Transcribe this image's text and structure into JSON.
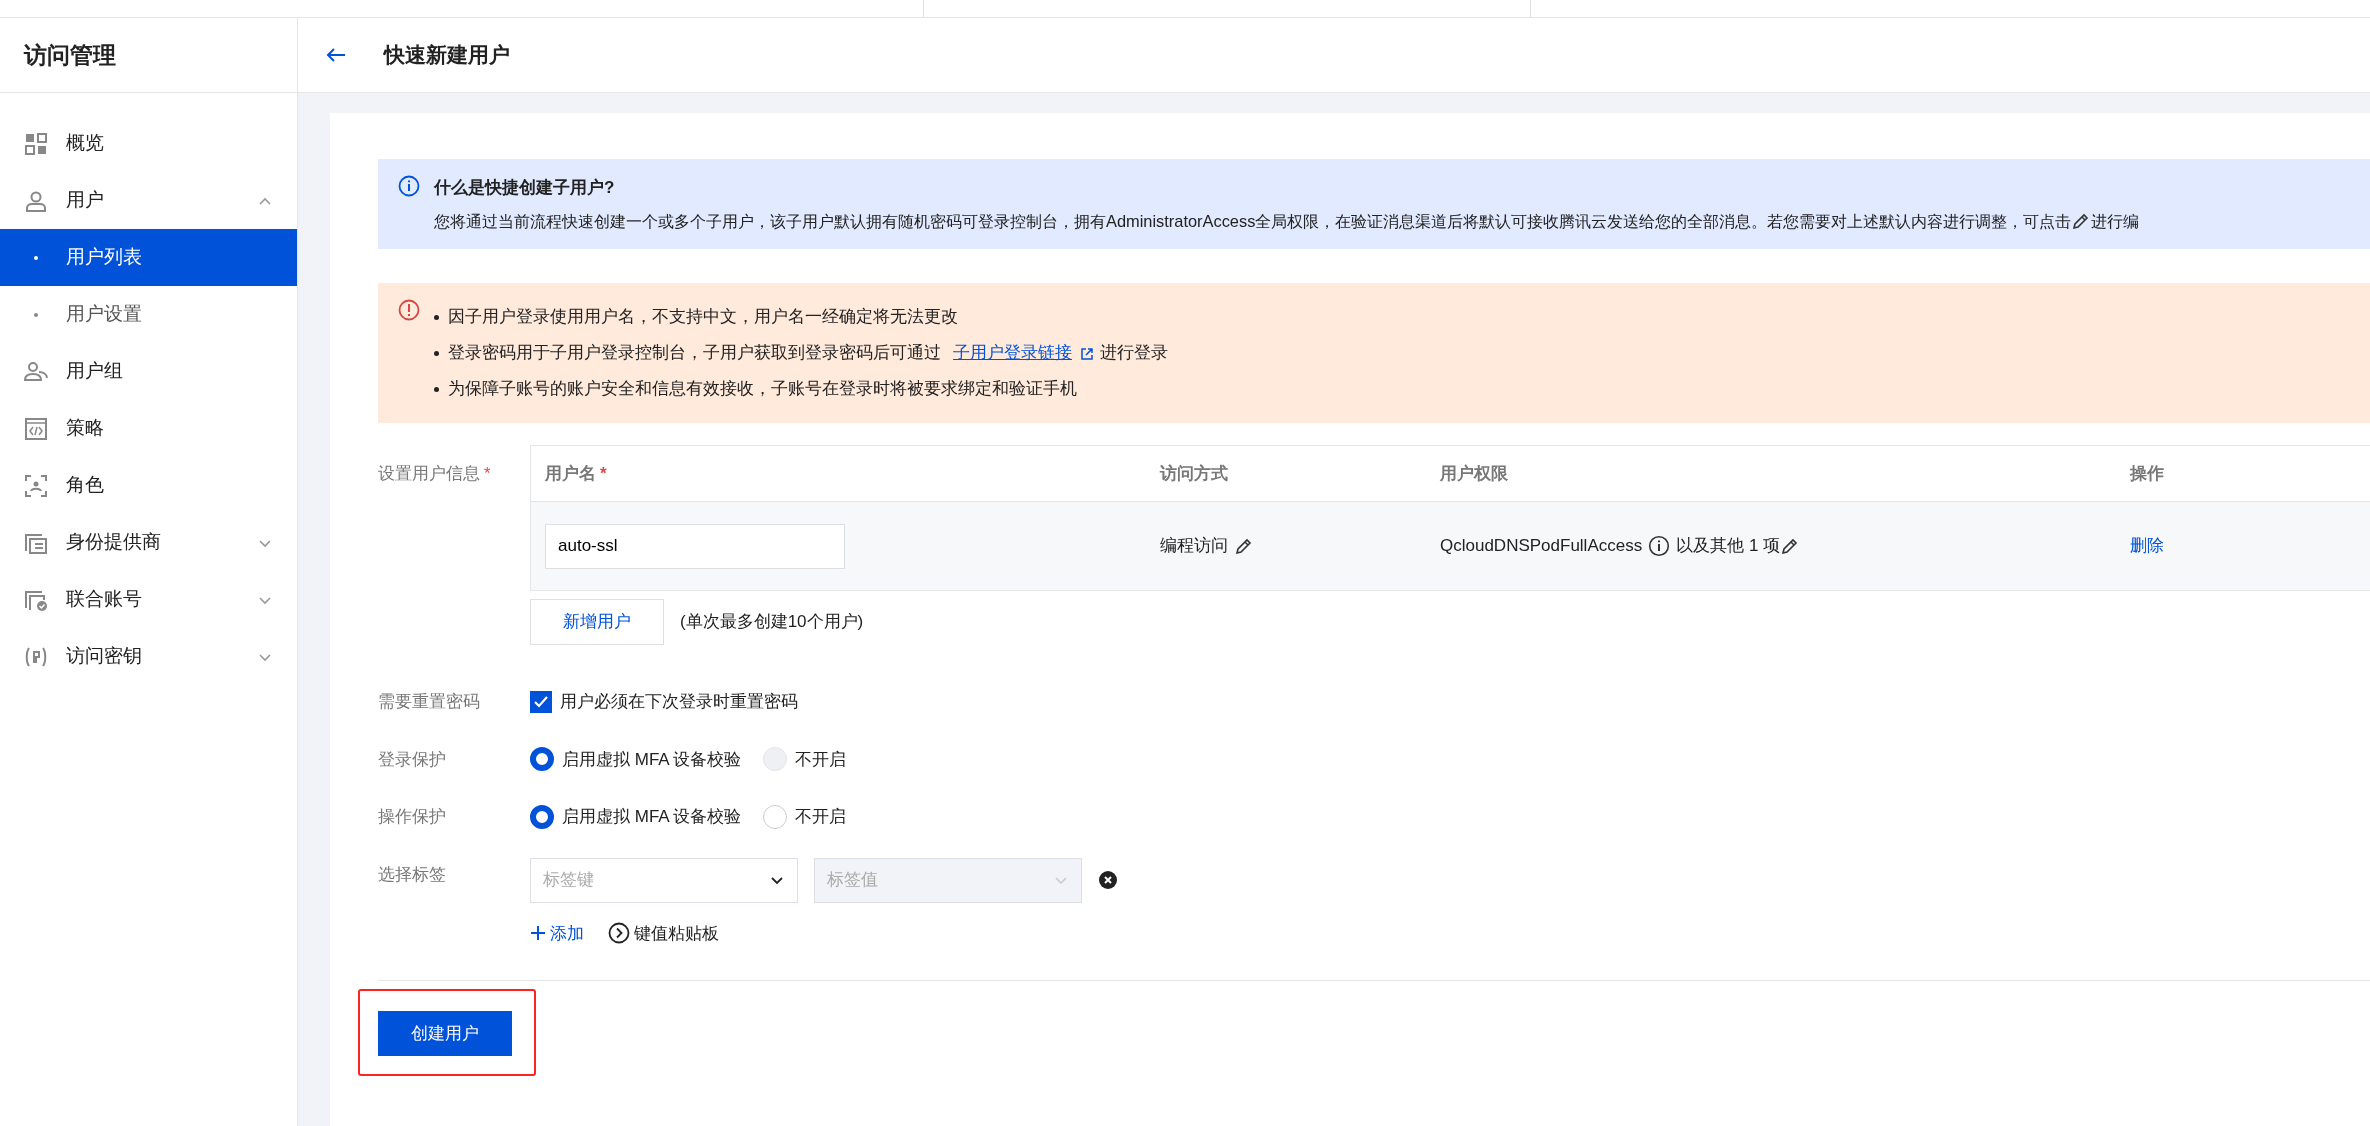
{
  "sidebar": {
    "title": "访问管理",
    "items": [
      {
        "label": "概览",
        "kind": "link",
        "selected": false
      },
      {
        "label": "用户",
        "kind": "group",
        "expanded": true,
        "selected": false,
        "children": [
          {
            "label": "用户列表",
            "selected": true
          },
          {
            "label": "用户设置",
            "selected": false
          }
        ]
      },
      {
        "label": "用户组",
        "kind": "link",
        "selected": false
      },
      {
        "label": "策略",
        "kind": "link",
        "selected": false
      },
      {
        "label": "角色",
        "kind": "link",
        "selected": false
      },
      {
        "label": "身份提供商",
        "kind": "group",
        "expanded": false,
        "selected": false
      },
      {
        "label": "联合账号",
        "kind": "group",
        "expanded": false,
        "selected": false
      },
      {
        "label": "访问密钥",
        "kind": "group",
        "expanded": false,
        "selected": false
      }
    ]
  },
  "header": {
    "title": "快速新建用户"
  },
  "info": {
    "title": "什么是快捷创建子用户?",
    "text": "您将通过当前流程快速创建一个或多个子用户，该子用户默认拥有随机密码可登录控制台，拥有AdministratorAccess全局权限，在验证消息渠道后将默认可接收腾讯云发送给您的全部消息。若您需要对上述默认内容进行调整，可点击",
    "text_after": "进行编"
  },
  "warning": {
    "items": [
      {
        "text": "因子用户登录使用用户名，不支持中文，用户名一经确定将无法更改"
      },
      {
        "text": "登录密码用于子用户登录控制台，子用户获取到登录密码后可通过",
        "link": "子用户登录链接",
        "text_after": "进行登录"
      },
      {
        "text": "为保障子账号的账户安全和信息有效接收，子账号在登录时将被要求绑定和验证手机"
      }
    ]
  },
  "user_table": {
    "label": "设置用户信息",
    "mark": "*",
    "columns": [
      {
        "label": "用户名",
        "mark": "*"
      },
      {
        "label": "访问方式"
      },
      {
        "label": "用户权限"
      },
      {
        "label": "操作"
      }
    ],
    "rows": [
      {
        "username": "auto-ssl",
        "access": "编程访问",
        "policy": "QcloudDNSPodFullAccess",
        "policy_more": "以及其他 1 项",
        "action": "删除"
      }
    ]
  },
  "add_user": {
    "button": "新增用户",
    "note": "(单次最多创建10个用户)"
  },
  "reset_password": {
    "label": "需要重置密码",
    "option": "用户必须在下次登录时重置密码",
    "checked": true
  },
  "login_protection": {
    "label": "登录保护",
    "options": [
      {
        "label": "启用虚拟 MFA 设备校验",
        "selected": true,
        "disabled": false
      },
      {
        "label": "不开启",
        "selected": false,
        "disabled": true
      }
    ]
  },
  "operation_protection": {
    "label": "操作保护",
    "options": [
      {
        "label": "启用虚拟 MFA 设备校验",
        "selected": true,
        "disabled": false
      },
      {
        "label": "不开启",
        "selected": false,
        "disabled": false
      }
    ]
  },
  "tags": {
    "label": "选择标签",
    "key_placeholder": "标签键",
    "value_placeholder": "标签值",
    "value_disabled": true,
    "add": "添加",
    "paste": "键值粘贴板"
  },
  "submit": {
    "label": "创建用户",
    "highlighted": true
  }
}
